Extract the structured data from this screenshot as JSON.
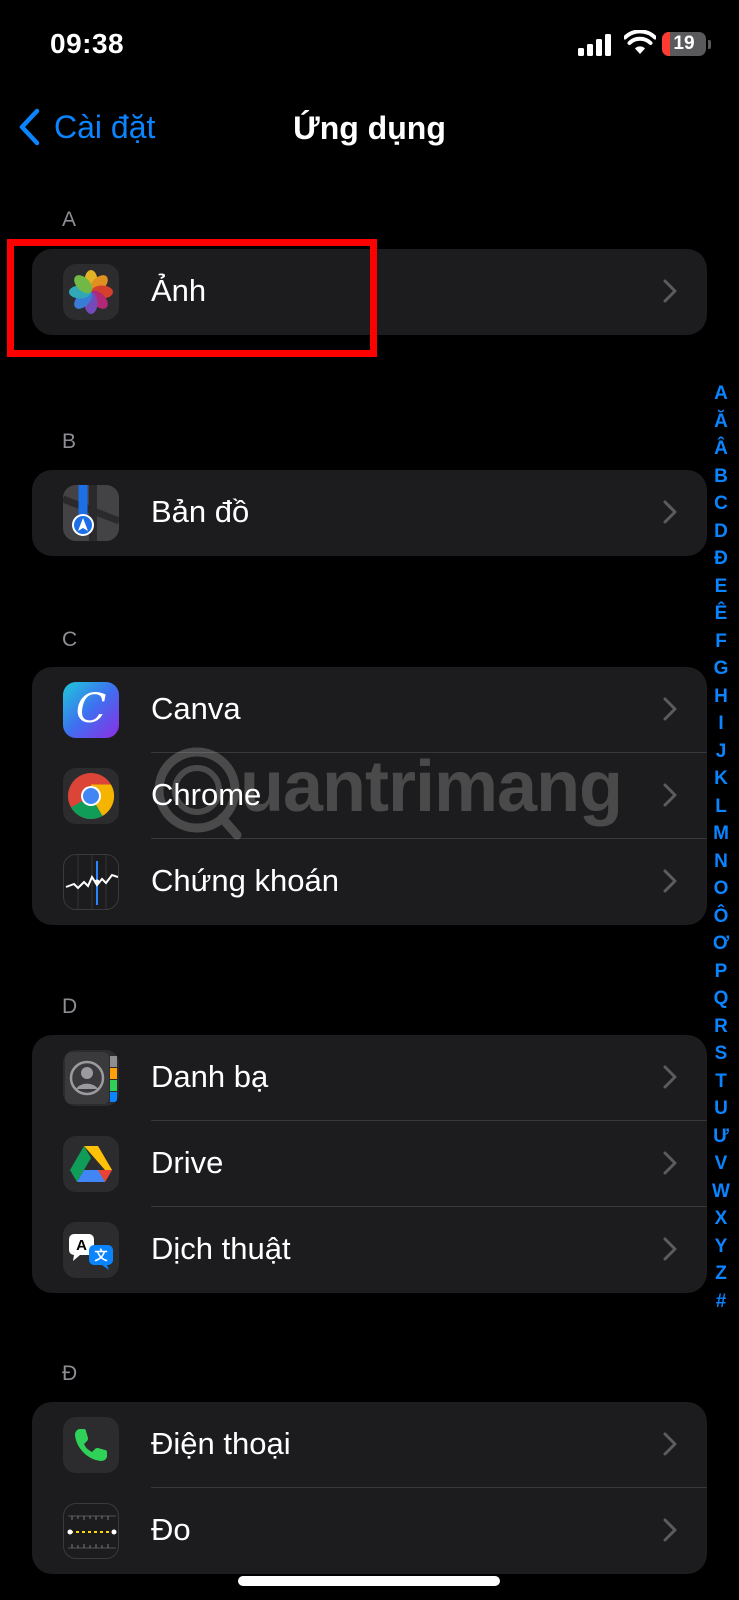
{
  "status_bar": {
    "time": "09:38",
    "battery": "19",
    "battery_level": 0.19
  },
  "nav": {
    "back_label": "Cài đặt",
    "title": "Ứng dụng"
  },
  "sections": [
    {
      "letter": "A",
      "items": [
        {
          "label": "Ảnh",
          "icon": "photos-icon"
        }
      ]
    },
    {
      "letter": "B",
      "items": [
        {
          "label": "Bản đồ",
          "icon": "maps-icon"
        }
      ]
    },
    {
      "letter": "C",
      "items": [
        {
          "label": "Canva",
          "icon": "canva-icon"
        },
        {
          "label": "Chrome",
          "icon": "chrome-icon"
        },
        {
          "label": "Chứng khoán",
          "icon": "stocks-icon"
        }
      ]
    },
    {
      "letter": "D",
      "items": [
        {
          "label": "Danh bạ",
          "icon": "contacts-icon"
        },
        {
          "label": "Drive",
          "icon": "google-drive-icon"
        },
        {
          "label": "Dịch thuật",
          "icon": "translate-icon"
        }
      ]
    },
    {
      "letter": "Đ",
      "items": [
        {
          "label": "Điện thoại",
          "icon": "phone-icon"
        },
        {
          "label": "Đo",
          "icon": "measure-icon"
        }
      ]
    }
  ],
  "index_letters": [
    "A",
    "Ă",
    "Â",
    "B",
    "C",
    "D",
    "Đ",
    "E",
    "Ê",
    "F",
    "G",
    "H",
    "I",
    "J",
    "K",
    "L",
    "M",
    "N",
    "O",
    "Ô",
    "Ơ",
    "P",
    "Q",
    "R",
    "S",
    "T",
    "U",
    "Ư",
    "V",
    "W",
    "X",
    "Y",
    "Z",
    "#"
  ],
  "watermark": {
    "text": "uantrimang"
  },
  "colors": {
    "accent": "#0a84ff",
    "highlight": "#ff0000",
    "cell_bg": "#1c1c1e",
    "battery_low": "#ff3b30"
  }
}
